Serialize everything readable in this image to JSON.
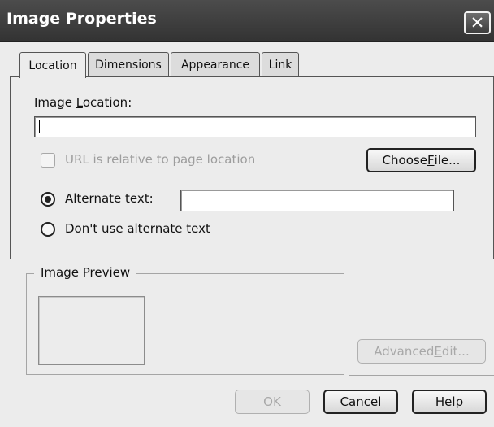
{
  "window": {
    "title": "Image Properties",
    "close_glyph": "✕"
  },
  "tabs": [
    {
      "label": "Location",
      "active": true
    },
    {
      "label": "Dimensions",
      "active": false
    },
    {
      "label": "Appearance",
      "active": false
    },
    {
      "label": "Link",
      "active": false
    }
  ],
  "location": {
    "label_before": "Image ",
    "label_mnemonic": "L",
    "label_after": "ocation:",
    "value": ""
  },
  "relative_url": {
    "label": "URL is relative to page location",
    "checked": false,
    "enabled": false
  },
  "choose_file": {
    "label_before": "Choose ",
    "label_mnemonic": "F",
    "label_after": "ile..."
  },
  "alt_text": {
    "option_label": "Alternate text:",
    "selected": true,
    "value": ""
  },
  "no_alt_text": {
    "option_label": "Don't use alternate text",
    "selected": false
  },
  "preview": {
    "legend": "Image Preview"
  },
  "advanced_edit": {
    "label_before": "Advanced ",
    "label_mnemonic": "E",
    "label_after": "dit...",
    "enabled": false
  },
  "footer": {
    "ok_label": "OK",
    "ok_enabled": false,
    "cancel_label": "Cancel",
    "help_label": "Help"
  }
}
